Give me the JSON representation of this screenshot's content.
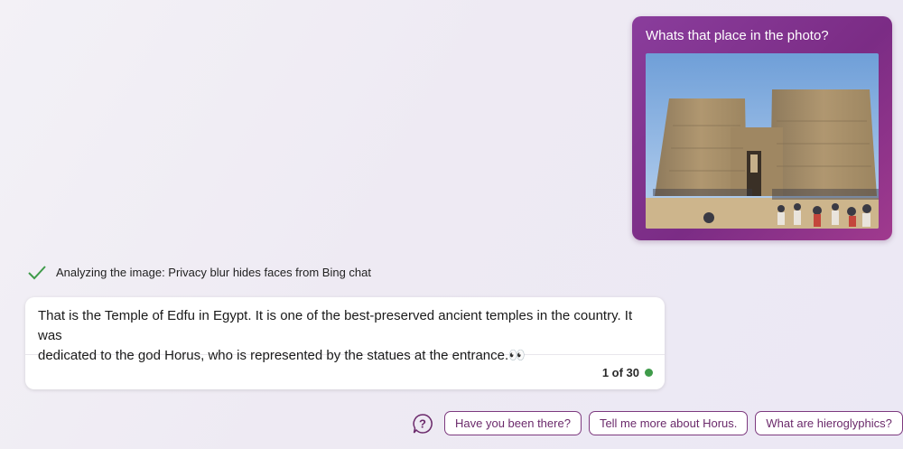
{
  "user_message": {
    "text": "Whats that place in the photo?",
    "image_alt": "photo-icon"
  },
  "status": {
    "text": "Analyzing the image: Privacy blur hides faces from Bing chat",
    "icon": "check-icon",
    "color": "#3f9b4a"
  },
  "bot_message": {
    "line1": "That is the Temple of Edfu in Egypt. It is one of the best-preserved ancient temples in the country. It was",
    "line2": "dedicated to the god Horus, who is represented by the statues at the entrance.👀",
    "counter": "1 of 30",
    "indicator_color": "#3f9b4a"
  },
  "suggestions": {
    "help_icon": "question-icon",
    "items": [
      "Have you been there?",
      "Tell me more about Horus.",
      "What are hieroglyphics?"
    ]
  },
  "colors": {
    "accent": "#7b2c85",
    "chip_text": "#6b2a6b"
  }
}
